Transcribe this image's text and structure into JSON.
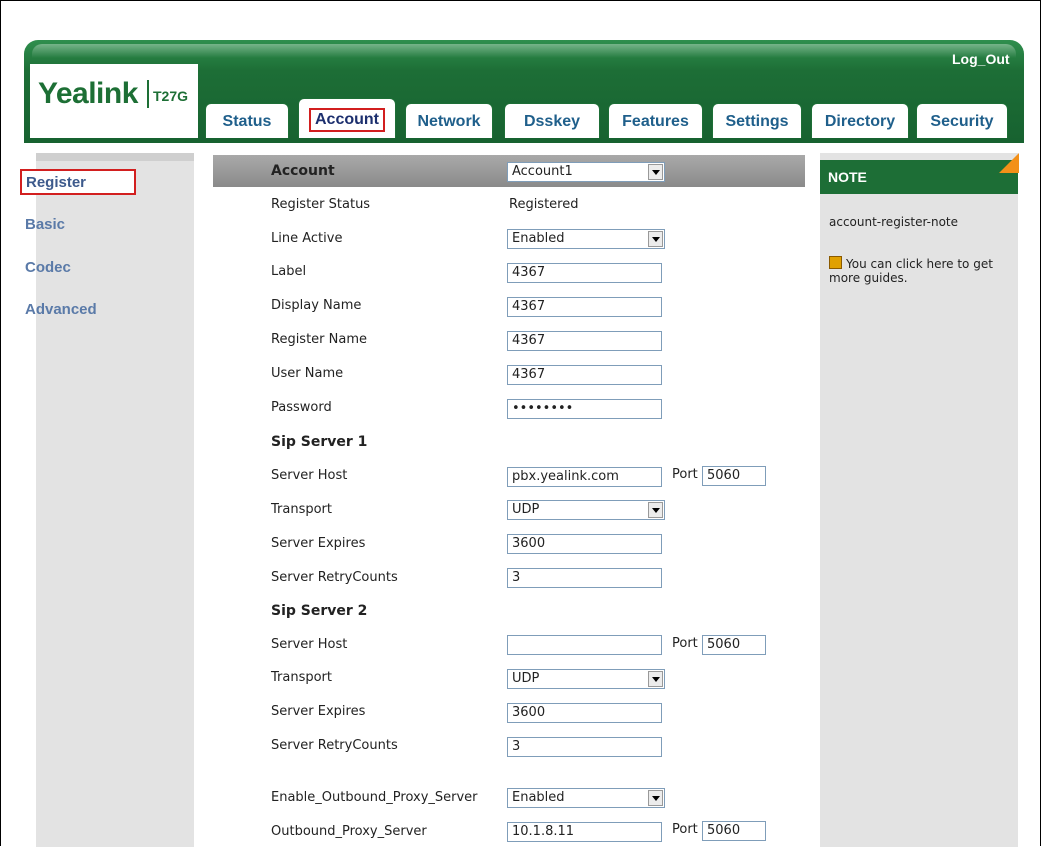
{
  "header": {
    "brand": "Yealink",
    "model": "T27G",
    "logout": "Log_Out",
    "tabs": [
      "Status",
      "Account",
      "Network",
      "Dsskey",
      "Features",
      "Settings",
      "Directory",
      "Security"
    ],
    "active_tab": "Account"
  },
  "sidebar": {
    "items": [
      "Register",
      "Basic",
      "Codec",
      "Advanced"
    ],
    "active": "Register"
  },
  "form": {
    "account_label": "Account",
    "account_value": "Account1",
    "register_status_label": "Register Status",
    "register_status_value": "Registered",
    "line_active_label": "Line Active",
    "line_active_value": "Enabled",
    "label_label": "Label",
    "label_value": "4367",
    "display_name_label": "Display Name",
    "display_name_value": "4367",
    "register_name_label": "Register Name",
    "register_name_value": "4367",
    "user_name_label": "User Name",
    "user_name_value": "4367",
    "password_label": "Password",
    "password_value": "••••••••",
    "sip1": {
      "title": "Sip Server 1",
      "server_host_label": "Server Host",
      "server_host_value": "pbx.yealink.com",
      "port_label": "Port",
      "port_value": "5060",
      "transport_label": "Transport",
      "transport_value": "UDP",
      "expires_label": "Server Expires",
      "expires_value": "3600",
      "retry_label": "Server RetryCounts",
      "retry_value": "3"
    },
    "sip2": {
      "title": "Sip Server 2",
      "server_host_label": "Server Host",
      "server_host_value": "",
      "port_label": "Port",
      "port_value": "5060",
      "transport_label": "Transport",
      "transport_value": "UDP",
      "expires_label": "Server Expires",
      "expires_value": "3600",
      "retry_label": "Server RetryCounts",
      "retry_value": "3"
    },
    "outbound_enable_label": "Enable_Outbound_Proxy_Server",
    "outbound_enable_value": "Enabled",
    "outbound_server_label": "Outbound_Proxy_Server",
    "outbound_server_value": "10.1.8.11",
    "outbound_port_label": "Port",
    "outbound_port_value": "5060"
  },
  "note": {
    "title": "NOTE",
    "text": "account-register-note",
    "guide": "You can click here to get more guides."
  },
  "colors": {
    "header_green": "#1d6e36",
    "highlight_red": "#d21f1f",
    "tab_text": "#1f5f8b",
    "note_corner": "#f39018"
  }
}
